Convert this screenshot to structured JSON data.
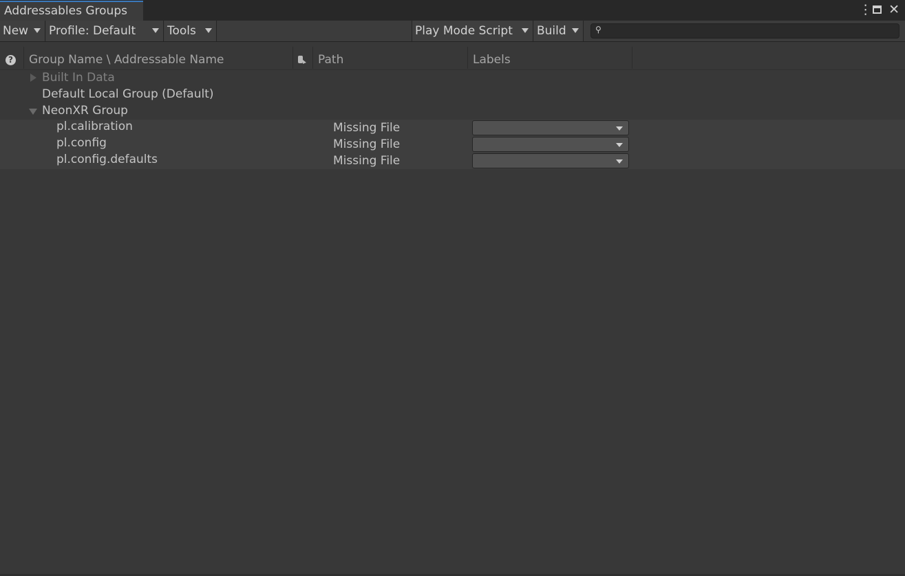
{
  "window": {
    "tab_title": "Addressables Groups",
    "icons": [
      "kebab-menu-icon",
      "maximize-icon",
      "close-icon"
    ],
    "close_glyph": "✕"
  },
  "toolbar": {
    "new_label": "New",
    "profile_label": "Profile: Default",
    "tools_label": "Tools",
    "play_mode_label": "Play Mode Script",
    "build_label": "Build",
    "search_value": ""
  },
  "columns": {
    "help_glyph": "?",
    "name": "Group Name \\ Addressable Name",
    "path": "Path",
    "labels": "Labels"
  },
  "tree": {
    "built_in": "Built In Data",
    "default_group": "Default Local Group (Default)",
    "neon_group": "NeonXR Group",
    "entries": [
      {
        "name": "pl.calibration",
        "path": "Missing File",
        "labels": ""
      },
      {
        "name": "pl.config",
        "path": "Missing File",
        "labels": ""
      },
      {
        "name": "pl.config.defaults",
        "path": "Missing File",
        "labels": ""
      }
    ]
  },
  "colors": {
    "background": "#383838",
    "tab_accent": "#3a79bb",
    "text": "#c4c4c4"
  }
}
